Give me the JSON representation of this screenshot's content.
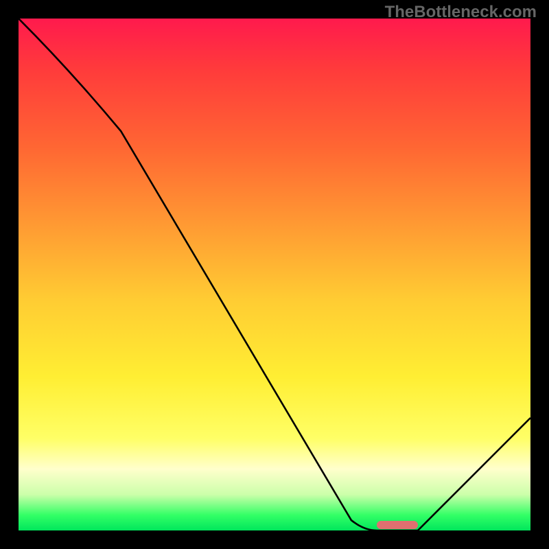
{
  "watermark": "TheBottleneck.com",
  "chart_data": {
    "type": "line",
    "title": "",
    "xlabel": "",
    "ylabel": "",
    "xlim": [
      0,
      100
    ],
    "ylim": [
      0,
      100
    ],
    "series": [
      {
        "name": "curve",
        "x": [
          0,
          20,
          65,
          70,
          78,
          100
        ],
        "values": [
          100,
          78,
          2,
          0,
          0,
          22
        ]
      }
    ],
    "marker": {
      "x_start": 70,
      "x_end": 78,
      "y": 0
    },
    "gradient_note": "vertical gradient red→green mapping y 100→0"
  }
}
